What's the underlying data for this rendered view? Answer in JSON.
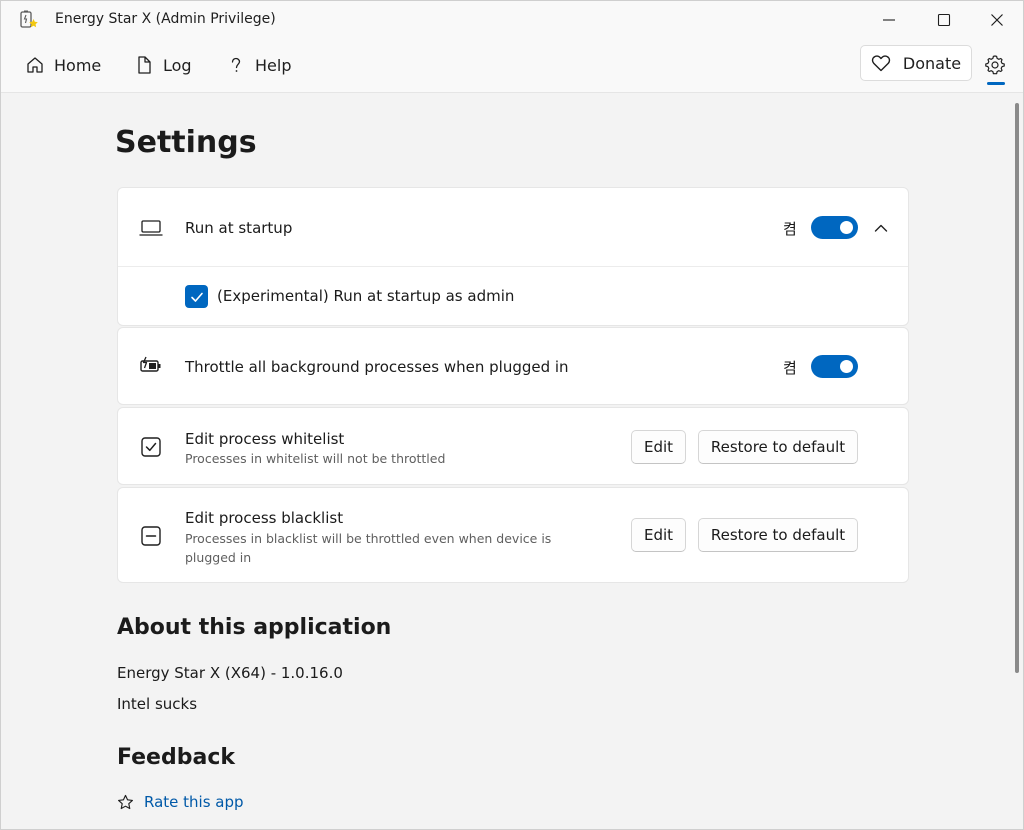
{
  "window": {
    "title": "Energy Star X  (Admin Privilege)",
    "accent_color": "#0067c0"
  },
  "nav": {
    "home_label": "Home",
    "log_label": "Log",
    "help_label": "Help",
    "donate_label": "Donate"
  },
  "page": {
    "title": "Settings"
  },
  "settings": {
    "run_at_startup": {
      "label": "Run at startup",
      "toggle_state_text": "켬",
      "enabled": true,
      "expanded": true,
      "admin_option_label": "(Experimental) Run at startup as admin",
      "admin_option_checked": true
    },
    "throttle": {
      "label": "Throttle all background processes when plugged in",
      "toggle_state_text": "켬",
      "enabled": true
    },
    "whitelist": {
      "label": "Edit process whitelist",
      "description": "Processes in whitelist will not be throttled",
      "edit_label": "Edit",
      "restore_label": "Restore to default"
    },
    "blacklist": {
      "label": "Edit process blacklist",
      "description": "Processes in blacklist will be throttled even when device is plugged in",
      "edit_label": "Edit",
      "restore_label": "Restore to default"
    }
  },
  "about": {
    "title": "About this application",
    "version": "Energy Star X (X64) - 1.0.16.0",
    "tagline": "Intel sucks"
  },
  "feedback": {
    "title": "Feedback",
    "rate_label": "Rate this app"
  }
}
